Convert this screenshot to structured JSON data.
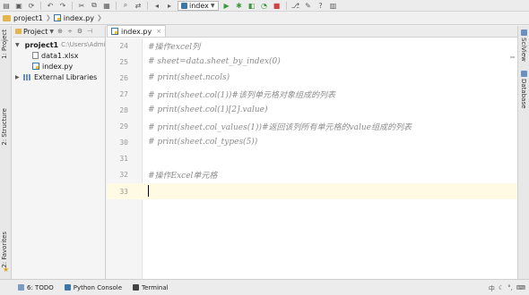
{
  "toolbar": {
    "run_config": "index",
    "buttons": [
      "open-icon",
      "save-icon",
      "sync-icon",
      "back-icon",
      "forward-icon",
      "cut-icon",
      "copy-icon",
      "paste-icon",
      "find-icon",
      "replace-icon",
      "nav-back-icon",
      "nav-forward-icon",
      "run-icon",
      "debug-icon",
      "coverage-icon",
      "stop-icon",
      "vcs-icon",
      "settings-icon",
      "help-icon",
      "structure-icon"
    ]
  },
  "navbar": {
    "project": "project1",
    "file": "index.py"
  },
  "left_strip": {
    "tab_project": "1: Project",
    "tab_structure": "2: Structure",
    "tab_favorites": "2: Favorites"
  },
  "project_panel": {
    "view_mode": "Project",
    "tree": [
      {
        "label": "project1",
        "path": "C:\\Users\\Admir",
        "kind": "folder",
        "expanded": true
      },
      {
        "label": "data1.xlsx",
        "kind": "xlsx"
      },
      {
        "label": "index.py",
        "kind": "python"
      },
      {
        "label": "External Libraries",
        "kind": "library",
        "expanded": false
      }
    ]
  },
  "editor": {
    "tab_label": "index.py",
    "lines": [
      {
        "num": "24",
        "code": "#操作excel列"
      },
      {
        "num": "25",
        "code": "# sheet=data.sheet_by_index(0)"
      },
      {
        "num": "26",
        "code": "# print(sheet.ncols)"
      },
      {
        "num": "27",
        "code": "# print(sheet.col(1))#该列单元格对象组成的列表"
      },
      {
        "num": "28",
        "code": "# print(sheet.col(1)[2].value)"
      },
      {
        "num": "29",
        "code": "# print(sheet.col_values(1))#返回该列所有单元格的value组成的列表"
      },
      {
        "num": "30",
        "code": "# print(sheet.col_types(5))"
      },
      {
        "num": "31",
        "code": ""
      },
      {
        "num": "32",
        "code": "#操作Excel单元格"
      },
      {
        "num": "33",
        "code": ""
      }
    ],
    "current_line": "33"
  },
  "right_strip": {
    "tab_sciview": "SciView",
    "tab_database": "Database"
  },
  "bottom_bar": {
    "todo": "6: TODO",
    "python_console": "Python Console",
    "terminal": "Terminal"
  },
  "colors": {
    "comment": "#8c8c8c",
    "current_line_bg": "#fffae3",
    "folder": "#e6b44c",
    "python_blue": "#3b77a8"
  }
}
